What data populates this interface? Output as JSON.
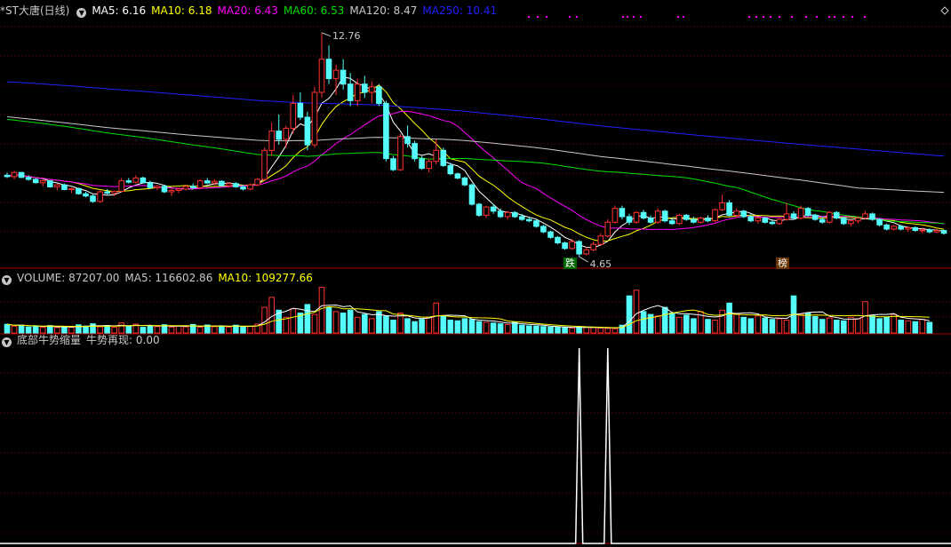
{
  "colors": {
    "up": "#ff3232",
    "down": "#54fcfc",
    "grid": "#7a0000",
    "divider": "#b00000",
    "text": "#c8c8c8",
    "ma5": "#ffffff",
    "ma10": "#ffff00",
    "ma20": "#ff00ff",
    "ma60": "#00e000",
    "ma120": "#c8c8c8",
    "ma250": "#2020ff",
    "signal": "#ffffff"
  },
  "price_panel": {
    "title": "*ST大唐(日线)",
    "indicators": [
      {
        "label": "MA5: 6.16",
        "color": "#ffffff"
      },
      {
        "label": "MA10: 6.18",
        "color": "#ffff00"
      },
      {
        "label": "MA20: 6.43",
        "color": "#ff00ff"
      },
      {
        "label": "MA60: 6.53",
        "color": "#00e000"
      },
      {
        "label": "MA120: 8.47",
        "color": "#c8c8c8"
      },
      {
        "label": "MA250: 10.41",
        "color": "#2020ff"
      }
    ],
    "high_label": "12.76",
    "low_label": "4.65",
    "tag_die": "跌",
    "tag_bang": "榜"
  },
  "volume_panel": {
    "indicators": [
      {
        "label": "VOLUME: 87207.00",
        "color": "#c8c8c8"
      },
      {
        "label": "MA5: 116602.86",
        "color": "#c8c8c8"
      },
      {
        "label": "MA10: 109277.66",
        "color": "#ffff00"
      }
    ]
  },
  "signal_panel": {
    "indicators": [
      {
        "label": "底部牛势缩量",
        "color": "#c8c8c8"
      },
      {
        "label": "牛势再现: 0.00",
        "color": "#c8c8c8"
      }
    ]
  },
  "chart_data": {
    "type": "candlestick",
    "price_range": [
      4.3,
      13.3
    ],
    "ohlc": [
      [
        7.6,
        7.7,
        7.5,
        7.55
      ],
      [
        7.55,
        7.75,
        7.45,
        7.7
      ],
      [
        7.7,
        7.72,
        7.5,
        7.52
      ],
      [
        7.52,
        7.6,
        7.4,
        7.45
      ],
      [
        7.45,
        7.5,
        7.3,
        7.33
      ],
      [
        7.33,
        7.45,
        7.2,
        7.4
      ],
      [
        7.4,
        7.42,
        7.15,
        7.18
      ],
      [
        7.18,
        7.3,
        7.05,
        7.25
      ],
      [
        7.25,
        7.3,
        7.05,
        7.08
      ],
      [
        7.08,
        7.15,
        6.95,
        7.12
      ],
      [
        7.12,
        7.15,
        6.9,
        6.93
      ],
      [
        6.93,
        7.0,
        6.8,
        6.85
      ],
      [
        6.85,
        6.9,
        6.6,
        6.65
      ],
      [
        6.65,
        7.05,
        6.6,
        7.0
      ],
      [
        7.0,
        7.1,
        6.9,
        6.95
      ],
      [
        6.95,
        7.05,
        6.85,
        7.02
      ],
      [
        7.02,
        7.5,
        7.0,
        7.4
      ],
      [
        7.4,
        7.5,
        7.3,
        7.35
      ],
      [
        7.35,
        7.6,
        7.3,
        7.5
      ],
      [
        7.5,
        7.55,
        7.3,
        7.33
      ],
      [
        7.33,
        7.4,
        7.1,
        7.15
      ],
      [
        7.15,
        7.25,
        7.05,
        7.2
      ],
      [
        7.2,
        7.25,
        6.95,
        7.0
      ],
      [
        7.0,
        7.1,
        6.85,
        7.05
      ],
      [
        7.05,
        7.15,
        6.95,
        7.1
      ],
      [
        7.1,
        7.25,
        7.05,
        7.2
      ],
      [
        7.2,
        7.3,
        7.1,
        7.15
      ],
      [
        7.15,
        7.45,
        7.1,
        7.4
      ],
      [
        7.4,
        7.5,
        7.3,
        7.32
      ],
      [
        7.32,
        7.45,
        7.25,
        7.38
      ],
      [
        7.38,
        7.42,
        7.2,
        7.22
      ],
      [
        7.22,
        7.35,
        7.15,
        7.3
      ],
      [
        7.3,
        7.35,
        7.15,
        7.18
      ],
      [
        7.18,
        7.25,
        7.05,
        7.1
      ],
      [
        7.1,
        7.3,
        7.05,
        7.25
      ],
      [
        7.25,
        7.5,
        7.2,
        7.45
      ],
      [
        7.45,
        8.6,
        7.4,
        8.5
      ],
      [
        8.5,
        9.5,
        8.3,
        9.2
      ],
      [
        9.2,
        9.8,
        8.7,
        8.9
      ],
      [
        8.9,
        9.4,
        8.6,
        9.3
      ],
      [
        9.3,
        10.5,
        9.1,
        10.2
      ],
      [
        10.2,
        10.6,
        9.6,
        9.7
      ],
      [
        9.7,
        9.9,
        8.5,
        8.7
      ],
      [
        8.7,
        10.8,
        8.6,
        10.6
      ],
      [
        10.6,
        12.76,
        10.4,
        11.8
      ],
      [
        11.8,
        12.3,
        10.9,
        11.1
      ],
      [
        11.1,
        11.6,
        10.5,
        11.4
      ],
      [
        11.4,
        11.8,
        10.7,
        10.9
      ],
      [
        10.9,
        11.3,
        10.1,
        10.3
      ],
      [
        10.3,
        11.1,
        10.1,
        10.9
      ],
      [
        10.9,
        11.2,
        10.4,
        10.6
      ],
      [
        10.6,
        11.0,
        10.2,
        10.8
      ],
      [
        10.8,
        10.9,
        10.1,
        10.2
      ],
      [
        10.2,
        10.3,
        8.1,
        8.2
      ],
      [
        8.2,
        8.3,
        7.75,
        7.8
      ],
      [
        7.8,
        9.1,
        7.75,
        9.0
      ],
      [
        9.0,
        9.4,
        8.6,
        8.75
      ],
      [
        8.75,
        8.85,
        8.1,
        8.2
      ],
      [
        8.2,
        8.3,
        7.8,
        7.85
      ],
      [
        7.85,
        8.2,
        7.7,
        8.1
      ],
      [
        8.1,
        8.9,
        8.0,
        8.5
      ],
      [
        8.5,
        8.6,
        7.9,
        7.95
      ],
      [
        7.95,
        8.05,
        7.6,
        7.65
      ],
      [
        7.65,
        7.7,
        7.45,
        7.5
      ],
      [
        7.5,
        7.55,
        7.2,
        7.25
      ],
      [
        7.25,
        7.3,
        6.5,
        6.55
      ],
      [
        6.55,
        6.6,
        6.1,
        6.15
      ],
      [
        6.15,
        6.5,
        6.05,
        6.45
      ],
      [
        6.45,
        6.55,
        6.2,
        6.3
      ],
      [
        6.3,
        6.4,
        6.05,
        6.1
      ],
      [
        6.1,
        6.3,
        6.0,
        6.25
      ],
      [
        6.25,
        6.3,
        6.05,
        6.1
      ],
      [
        6.1,
        6.2,
        5.95,
        6.0
      ],
      [
        6.0,
        6.1,
        5.9,
        5.95
      ],
      [
        5.95,
        6.0,
        5.7,
        5.75
      ],
      [
        5.75,
        5.8,
        5.5,
        5.55
      ],
      [
        5.55,
        5.6,
        5.3,
        5.35
      ],
      [
        5.35,
        5.4,
        5.1,
        5.15
      ],
      [
        5.15,
        5.2,
        4.9,
        4.95
      ],
      [
        4.95,
        5.3,
        4.9,
        5.2
      ],
      [
        5.2,
        5.25,
        4.65,
        4.75
      ],
      [
        4.75,
        5.0,
        4.7,
        4.9
      ],
      [
        4.9,
        5.2,
        4.85,
        5.1
      ],
      [
        5.1,
        5.5,
        5.05,
        5.4
      ],
      [
        5.4,
        6.0,
        5.35,
        5.9
      ],
      [
        5.9,
        6.5,
        5.85,
        6.4
      ],
      [
        6.4,
        6.5,
        6.0,
        6.1
      ],
      [
        6.1,
        6.2,
        5.8,
        5.9
      ],
      [
        5.9,
        6.3,
        5.85,
        6.25
      ],
      [
        6.25,
        6.35,
        6.0,
        6.05
      ],
      [
        6.05,
        6.15,
        5.85,
        5.9
      ],
      [
        5.9,
        6.4,
        5.85,
        6.3
      ],
      [
        6.3,
        6.35,
        5.9,
        5.95
      ],
      [
        5.95,
        6.05,
        5.8,
        5.85
      ],
      [
        5.85,
        6.2,
        5.8,
        6.15
      ],
      [
        6.15,
        6.2,
        5.95,
        6.0
      ],
      [
        6.0,
        6.1,
        5.85,
        5.9
      ],
      [
        5.9,
        6.1,
        5.85,
        6.05
      ],
      [
        6.05,
        6.15,
        5.9,
        5.95
      ],
      [
        5.95,
        6.4,
        5.9,
        6.35
      ],
      [
        6.35,
        6.9,
        6.3,
        6.6
      ],
      [
        6.6,
        6.7,
        6.1,
        6.15
      ],
      [
        6.15,
        6.4,
        6.05,
        6.3
      ],
      [
        6.3,
        6.35,
        6.05,
        6.1
      ],
      [
        6.1,
        6.2,
        5.9,
        5.95
      ],
      [
        5.95,
        6.1,
        5.85,
        6.05
      ],
      [
        6.05,
        6.1,
        5.85,
        5.9
      ],
      [
        5.9,
        6.0,
        5.8,
        5.85
      ],
      [
        5.85,
        6.05,
        5.8,
        6.0
      ],
      [
        6.0,
        6.6,
        5.95,
        6.2
      ],
      [
        6.2,
        6.3,
        6.0,
        6.05
      ],
      [
        6.05,
        6.5,
        6.0,
        6.4
      ],
      [
        6.4,
        6.45,
        6.1,
        6.15
      ],
      [
        6.15,
        6.2,
        5.95,
        6.0
      ],
      [
        6.0,
        6.1,
        5.85,
        5.9
      ],
      [
        5.9,
        6.3,
        5.85,
        6.25
      ],
      [
        6.25,
        6.3,
        6.0,
        6.05
      ],
      [
        6.05,
        6.1,
        5.8,
        5.85
      ],
      [
        5.85,
        6.0,
        5.75,
        5.95
      ],
      [
        5.95,
        6.1,
        5.85,
        6.05
      ],
      [
        6.05,
        6.3,
        6.0,
        6.2
      ],
      [
        6.2,
        6.25,
        5.95,
        6.0
      ],
      [
        6.0,
        6.05,
        5.75,
        5.8
      ],
      [
        5.8,
        5.85,
        5.6,
        5.65
      ],
      [
        5.65,
        5.8,
        5.6,
        5.75
      ],
      [
        5.75,
        5.8,
        5.6,
        5.65
      ],
      [
        5.65,
        5.75,
        5.55,
        5.7
      ],
      [
        5.7,
        5.75,
        5.55,
        5.6
      ],
      [
        5.6,
        5.7,
        5.5,
        5.62
      ],
      [
        5.62,
        5.68,
        5.5,
        5.55
      ],
      [
        5.55,
        5.65,
        5.5,
        5.6
      ],
      [
        5.6,
        5.62,
        5.45,
        5.5
      ]
    ],
    "volume_range": [
      0,
      330000
    ],
    "volume": [
      61000,
      48000,
      55000,
      42000,
      46000,
      40000,
      52000,
      38000,
      44000,
      39000,
      57000,
      49000,
      65000,
      43000,
      51000,
      41000,
      71000,
      47000,
      62000,
      40000,
      53000,
      45000,
      58000,
      42000,
      49000,
      43000,
      60000,
      41000,
      56000,
      44000,
      50000,
      42000,
      55000,
      40000,
      46000,
      62000,
      180000,
      250000,
      160000,
      110000,
      170000,
      140000,
      200000,
      130000,
      320000,
      180000,
      150000,
      140000,
      160000,
      110000,
      130000,
      100000,
      150000,
      120000,
      90000,
      140000,
      100000,
      80000,
      95000,
      110000,
      210000,
      120000,
      90000,
      85000,
      100000,
      95000,
      80000,
      75000,
      70000,
      65000,
      60000,
      75000,
      55000,
      50000,
      48000,
      45000,
      42000,
      40000,
      38000,
      35000,
      40000,
      42000,
      38000,
      35000,
      32000,
      30000,
      55000,
      260000,
      300000,
      150000,
      130000,
      120000,
      180000,
      140000,
      110000,
      125000,
      100000,
      150000,
      95000,
      90000,
      160000,
      210000,
      130000,
      110000,
      100000,
      120000,
      105000,
      95000,
      100000,
      90000,
      260000,
      130000,
      140000,
      115000,
      95000,
      105000,
      90000,
      85000,
      110000,
      100000,
      220000,
      120000,
      100000,
      110000,
      130000,
      90000,
      85000,
      80000,
      95000,
      75000
    ],
    "signal": {
      "range": [
        0,
        1
      ],
      "spikes_at_bar": [
        80,
        84
      ]
    }
  }
}
